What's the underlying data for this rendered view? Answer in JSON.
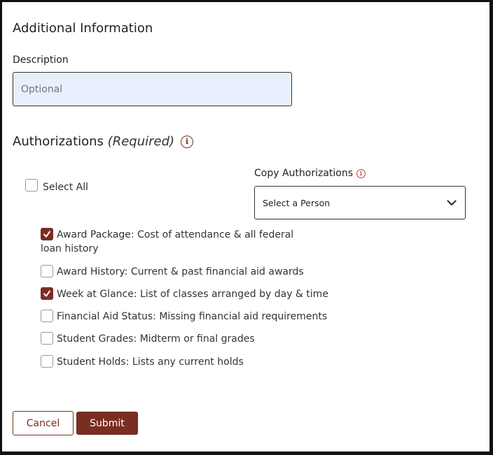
{
  "additional_info": {
    "title": "Additional Information",
    "description_label": "Description",
    "description_placeholder": "Optional",
    "description_value": ""
  },
  "authorizations": {
    "title": "Authorizations",
    "required_text": "(Required)",
    "info_icon": "info-circle-icon",
    "select_all_label": "Select All",
    "select_all_checked": false,
    "copy_label": "Copy Authorizations",
    "copy_info_icon": "info-circle-icon",
    "copy_select_value": "Select a Person",
    "copy_select_icon": "chevron-down-icon",
    "options": [
      {
        "label": "Award Package: Cost of attendance & all federal loan history",
        "checked": true
      },
      {
        "label": "Award History: Current & past financial aid awards",
        "checked": false
      },
      {
        "label": "Week at Glance: List of classes arranged by day & time",
        "checked": true
      },
      {
        "label": "Financial Aid Status: Missing financial aid requirements",
        "checked": false
      },
      {
        "label": "Student Grades: Midterm or final grades",
        "checked": false
      },
      {
        "label": "Student Holds: Lists any current holds",
        "checked": false
      }
    ]
  },
  "buttons": {
    "cancel_label": "Cancel",
    "submit_label": "Submit"
  },
  "colors": {
    "accent": "#7a2e22",
    "input_background": "#e8f0fe",
    "info_icon_small": "#d03a2a"
  }
}
